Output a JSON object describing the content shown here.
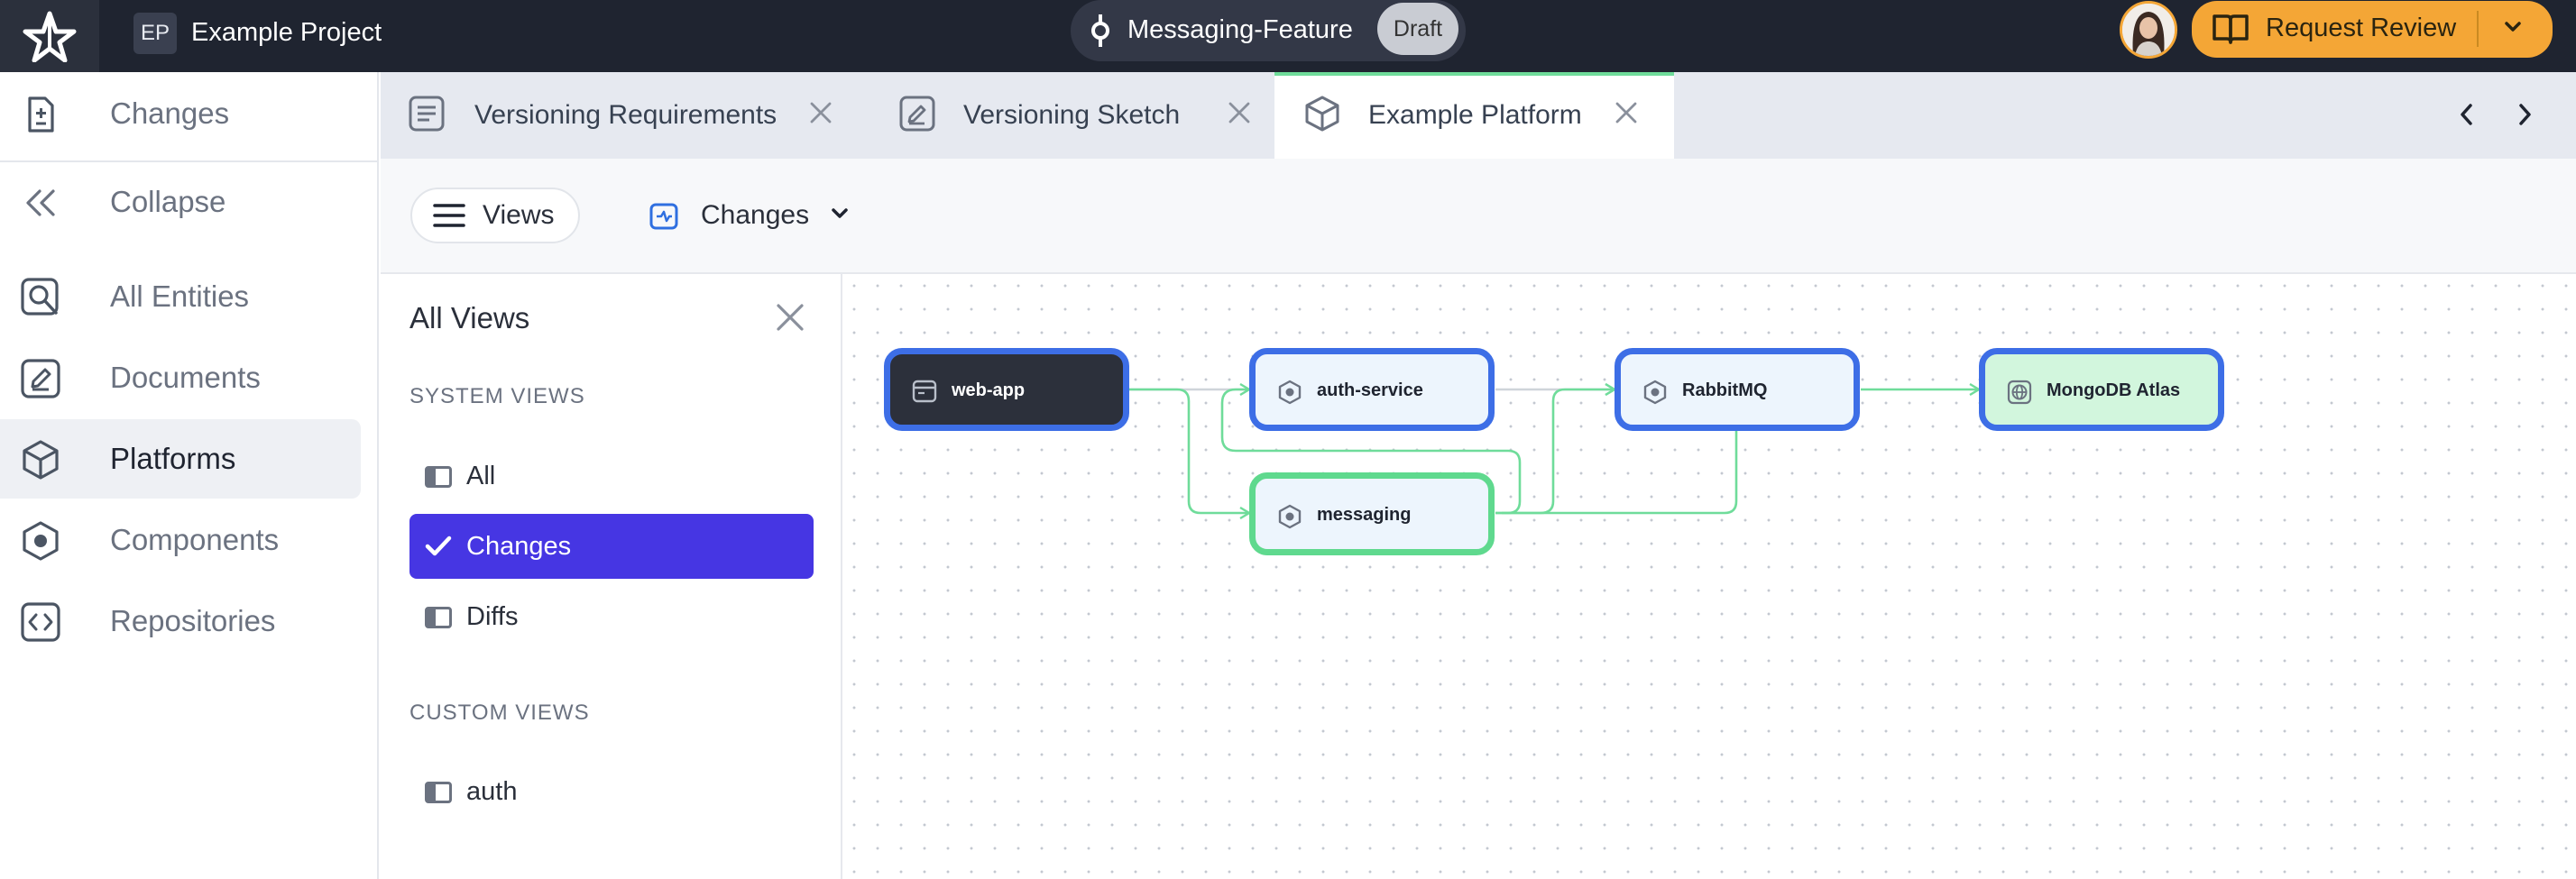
{
  "topbar": {
    "project_badge": "EP",
    "project_name": "Example Project",
    "branch_name": "Messaging-Feature",
    "branch_status": "Draft",
    "review_button": "Request Review",
    "accent_color": "#f4a636"
  },
  "sidebar": {
    "changes": "Changes",
    "collapse": "Collapse",
    "items": [
      {
        "label": "All Entities",
        "icon": "search-entities-icon"
      },
      {
        "label": "Documents",
        "icon": "document-icon"
      },
      {
        "label": "Platforms",
        "icon": "platform-cube-icon",
        "active": true
      },
      {
        "label": "Components",
        "icon": "component-hexagon-icon"
      },
      {
        "label": "Repositories",
        "icon": "code-brackets-icon"
      }
    ]
  },
  "tabs": [
    {
      "label": "Versioning Requirements",
      "icon": "document-icon"
    },
    {
      "label": "Versioning Sketch",
      "icon": "sketch-icon"
    },
    {
      "label": "Example Platform",
      "icon": "platform-cube-icon",
      "active": true
    }
  ],
  "toolbar": {
    "views_button": "Views",
    "current_view": "Changes"
  },
  "views_panel": {
    "title": "All Views",
    "system_section": "SYSTEM VIEWS",
    "system_views": [
      "All",
      "Changes",
      "Diffs"
    ],
    "selected_view": "Changes",
    "custom_section": "CUSTOM VIEWS",
    "custom_views": [
      "auth"
    ]
  },
  "diagram": {
    "nodes": [
      {
        "id": "web-app",
        "label": "web-app",
        "style": "dark"
      },
      {
        "id": "auth-service",
        "label": "auth-service",
        "style": "light"
      },
      {
        "id": "messaging",
        "label": "messaging",
        "style": "green-border"
      },
      {
        "id": "rabbitmq",
        "label": "RabbitMQ",
        "style": "light"
      },
      {
        "id": "mongodb-atlas",
        "label": "MongoDB Atlas",
        "style": "green-fill"
      }
    ],
    "edges": [
      {
        "from": "web-app",
        "to": "auth-service"
      },
      {
        "from": "web-app",
        "to": "messaging"
      },
      {
        "from": "auth-service",
        "to": "rabbitmq"
      },
      {
        "from": "messaging",
        "to": "rabbitmq"
      },
      {
        "from": "rabbitmq",
        "to": "messaging"
      },
      {
        "from": "rabbitmq",
        "to": "mongodb-atlas"
      }
    ],
    "edge_color": "#6fdc9a",
    "node_border_color": "#3d6ee6"
  }
}
